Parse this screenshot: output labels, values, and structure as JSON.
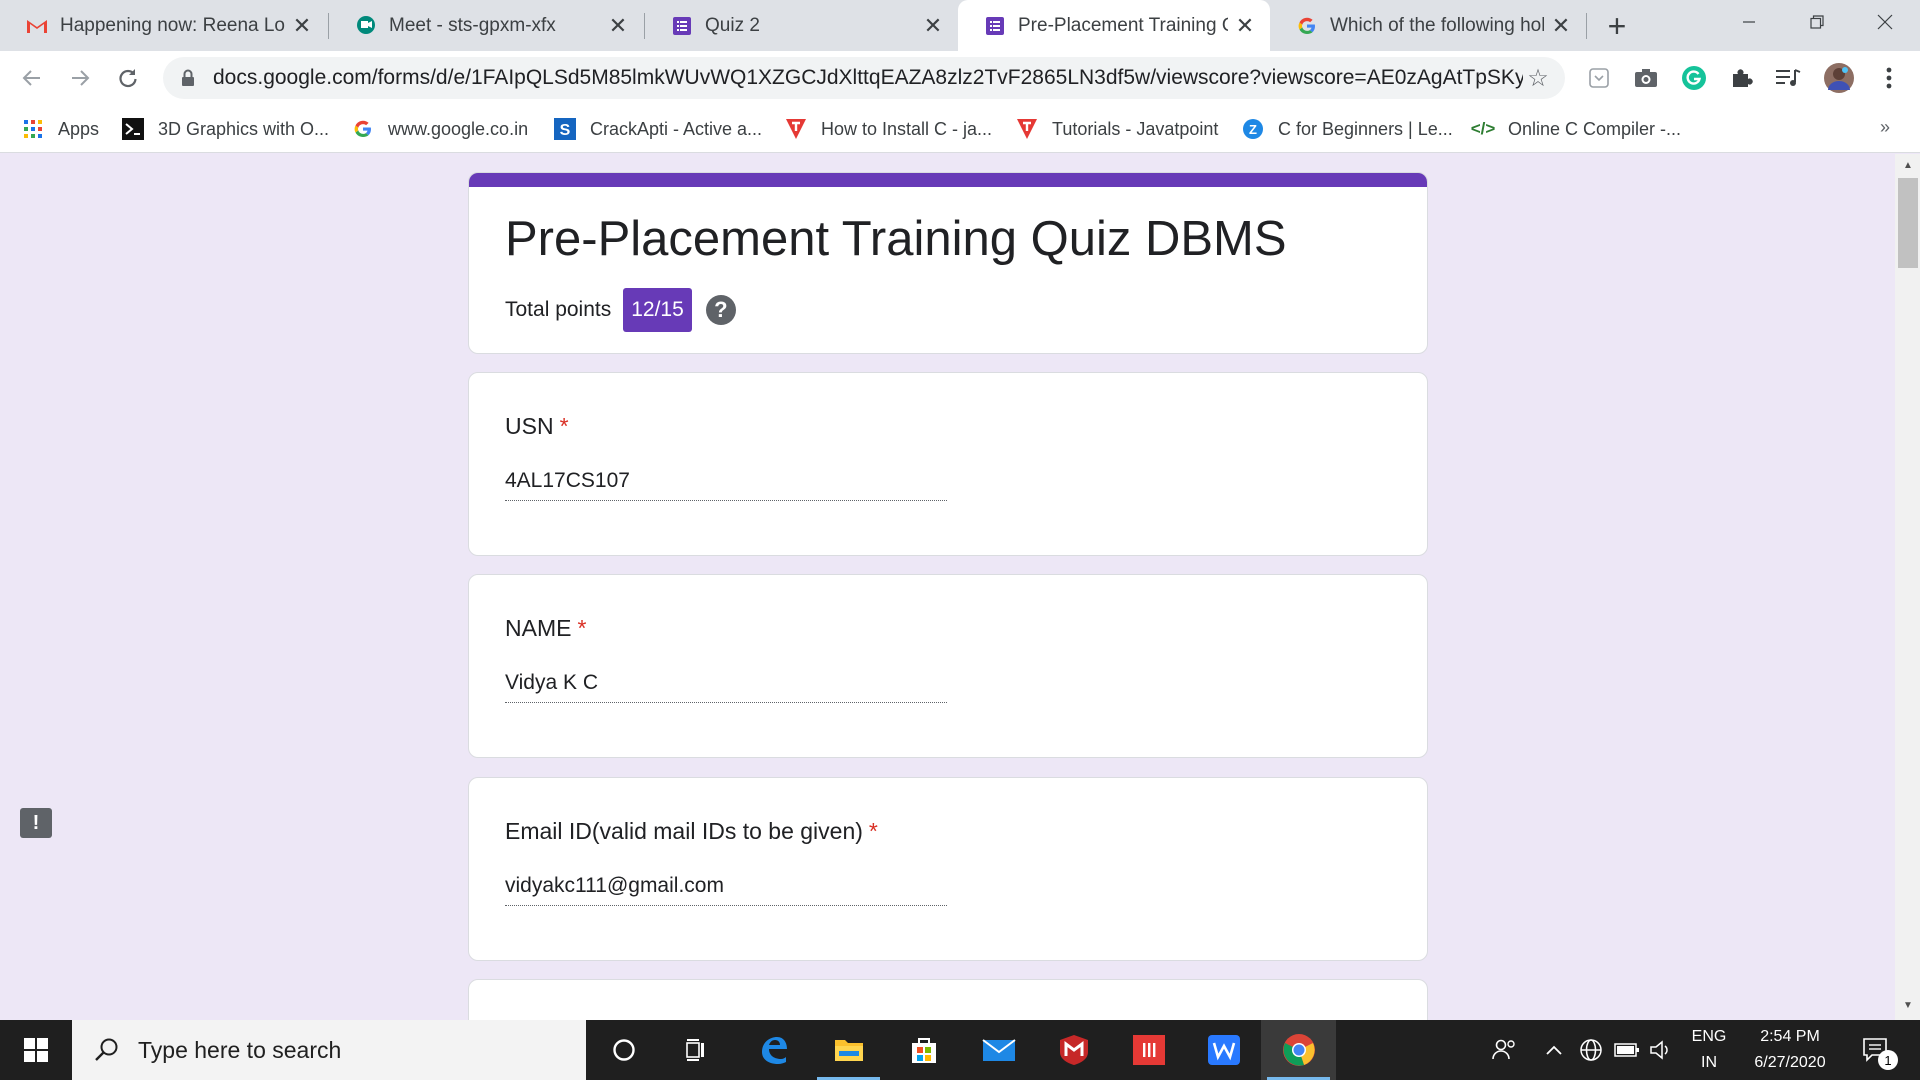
{
  "tabs": [
    {
      "title": "Happening now: Reena Lob",
      "icon": "gmail-icon",
      "active": false
    },
    {
      "title": "Meet - sts-gpxm-xfx",
      "icon": "meet-icon",
      "active": false
    },
    {
      "title": "Quiz 2",
      "icon": "google-forms-icon",
      "active": false
    },
    {
      "title": "Pre-Placement Training Qui",
      "icon": "google-forms-icon",
      "active": true
    },
    {
      "title": "Which of the following hold",
      "icon": "google-icon",
      "active": false
    }
  ],
  "toolbar": {
    "url": "docs.google.com/forms/d/e/1FAIpQLSd5M85lmkWUvWQ1XZGCJdXlttqEAZA8zlz2TvF2865LN3df5w/viewscore?viewscore=AE0zAgAtTpSKy..."
  },
  "bookmarks": [
    {
      "label": "Apps",
      "icon": "apps-grid-icon"
    },
    {
      "label": "3D Graphics with O...",
      "icon": "terminal-icon"
    },
    {
      "label": "www.google.co.in",
      "icon": "google-icon"
    },
    {
      "label": "CrackApti - Active a...",
      "icon": "crackapti-icon"
    },
    {
      "label": "How to Install C - ja...",
      "icon": "javatpoint-icon"
    },
    {
      "label": "Tutorials - Javatpoint",
      "icon": "javatpoint-icon"
    },
    {
      "label": "C for Beginners | Le...",
      "icon": "learn-icon"
    },
    {
      "label": "Online C Compiler -...",
      "icon": "code-icon"
    }
  ],
  "form": {
    "title": "Pre-Placement Training Quiz DBMS",
    "points_label": "Total points",
    "points_value": "12/15",
    "questions": [
      {
        "label": "USN",
        "required": "*",
        "answer": "4AL17CS107"
      },
      {
        "label": "NAME",
        "required": "*",
        "answer": "Vidya K C"
      },
      {
        "label": "Email ID(valid mail IDs to be given)",
        "required": "*",
        "answer": "vidyakc111@gmail.com"
      }
    ]
  },
  "taskbar": {
    "search_placeholder": "Type here to search",
    "lang_top": "ENG",
    "lang_bottom": "IN",
    "time": "2:54 PM",
    "date": "6/27/2020",
    "notification_count": "1"
  },
  "colors": {
    "accent": "#673ab7",
    "page_bg": "#ede7f6",
    "required": "#d93025"
  }
}
